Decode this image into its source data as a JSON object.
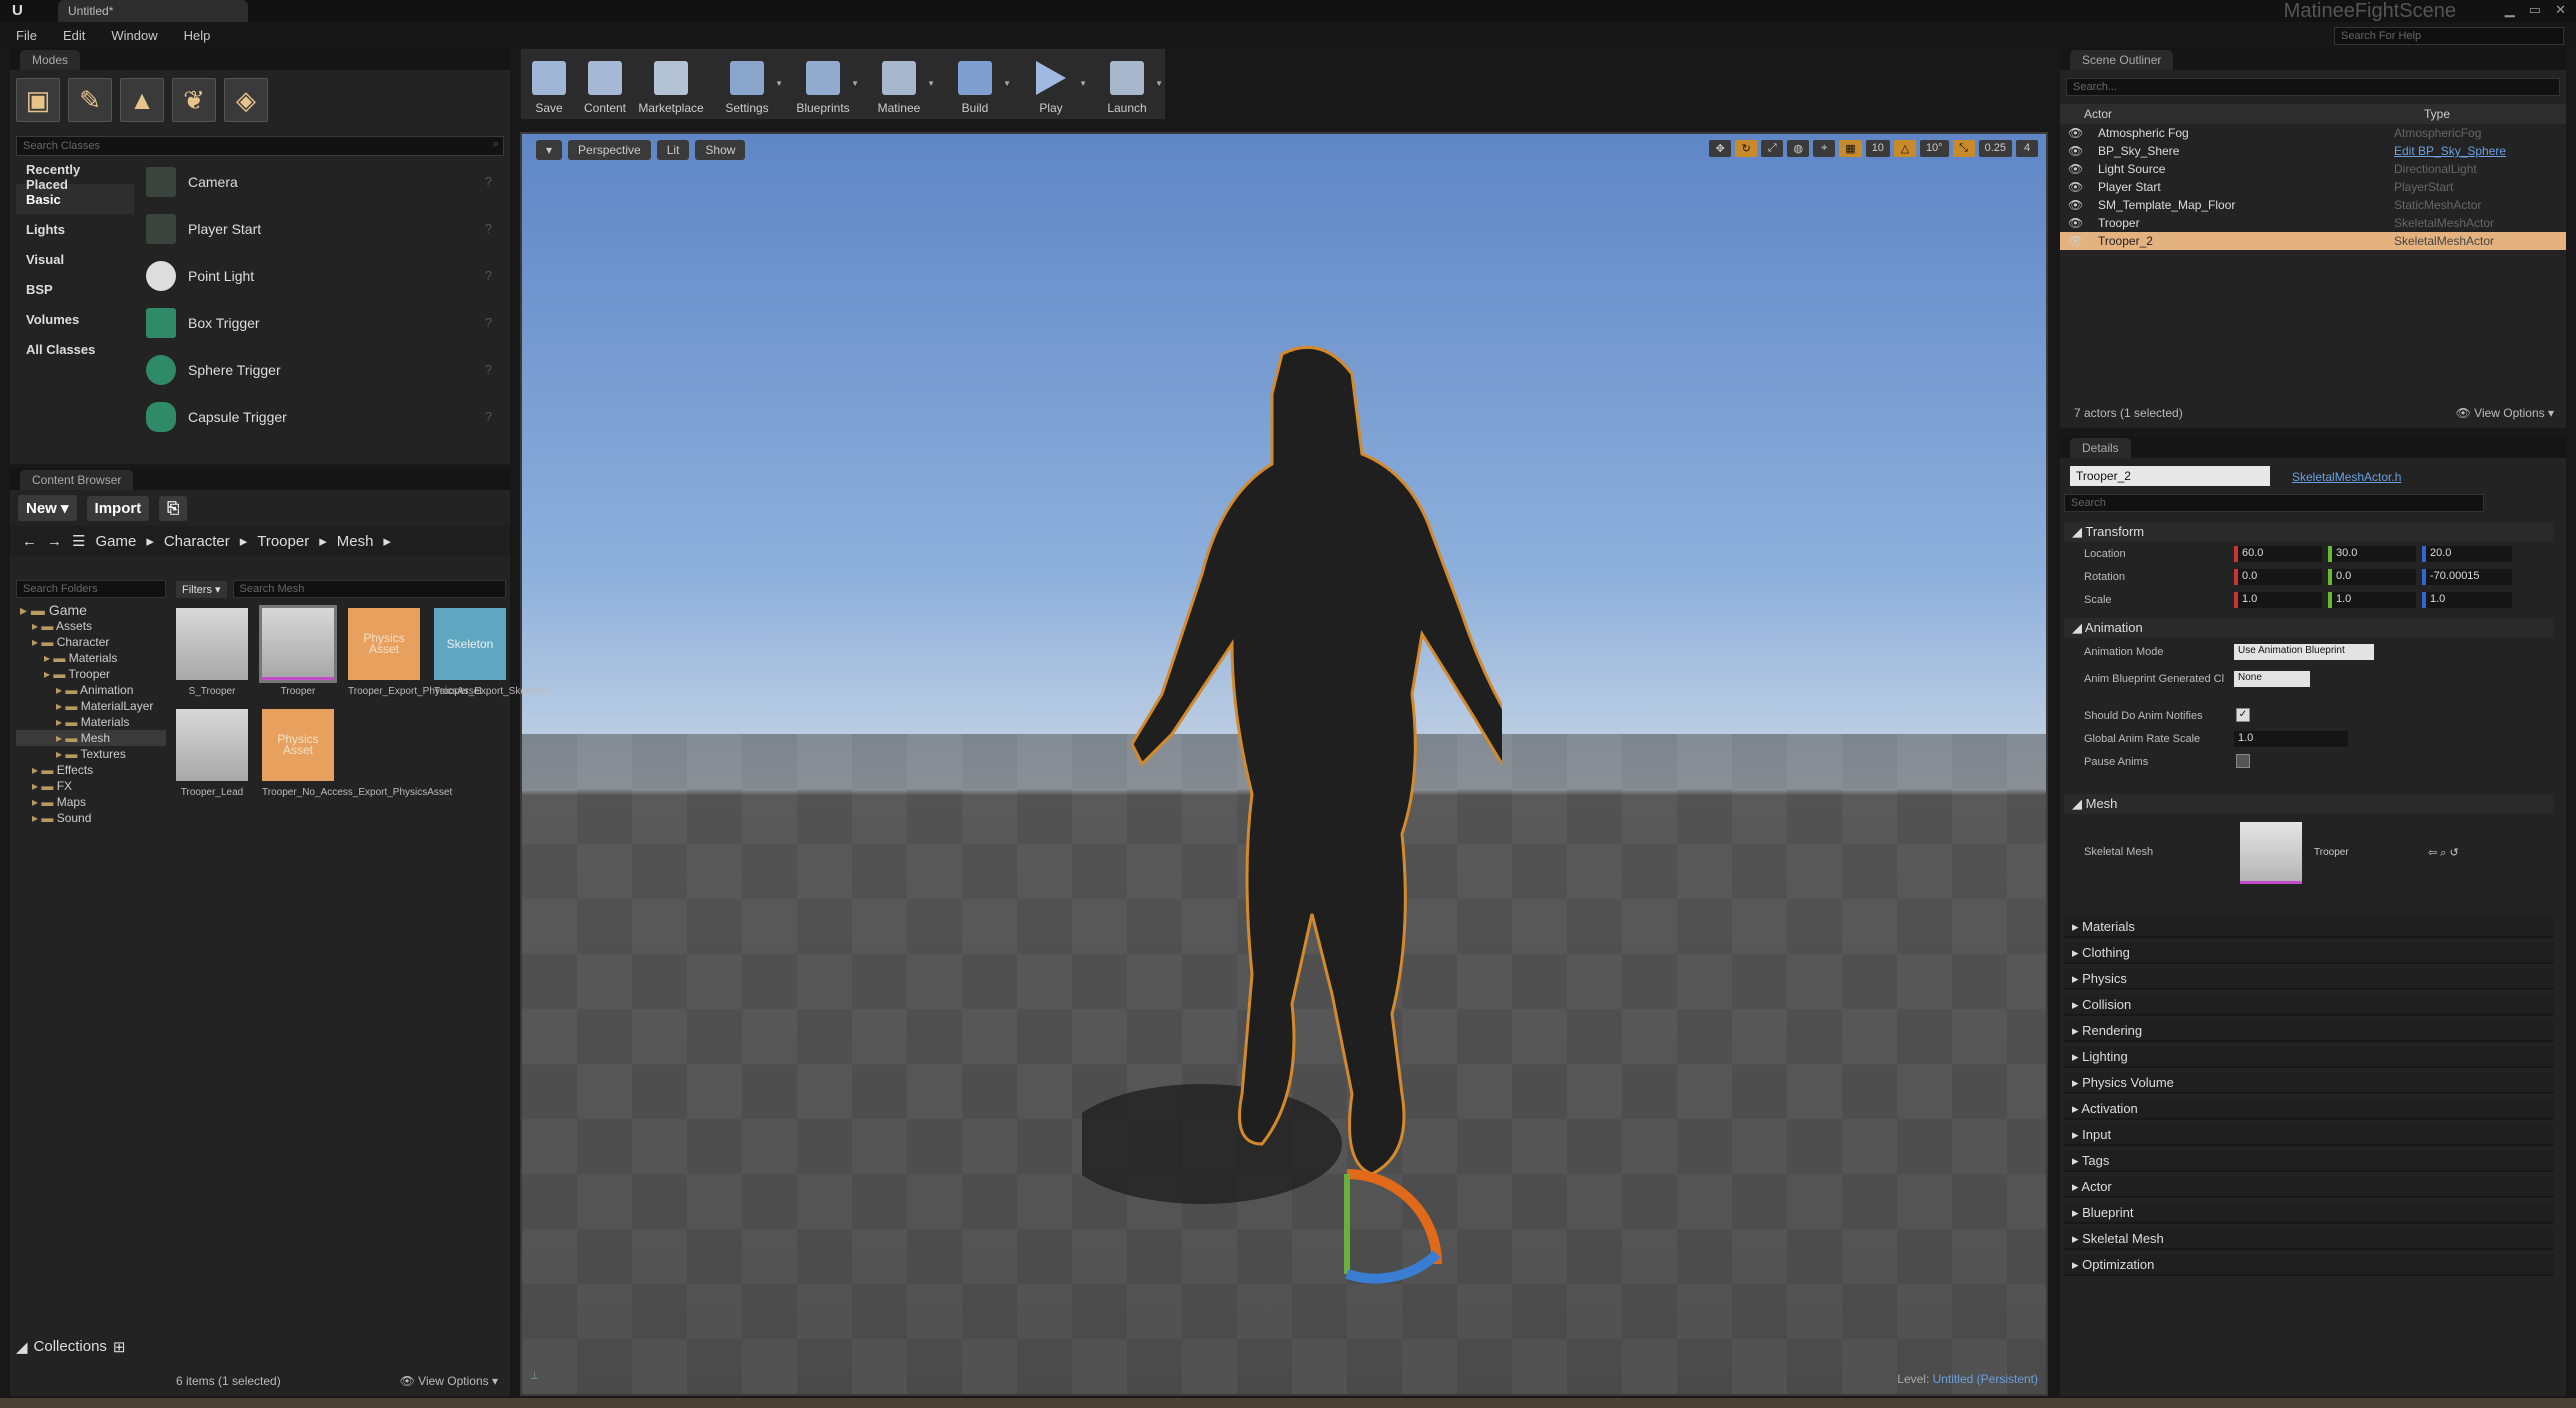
{
  "window": {
    "tab_title": "Untitled*",
    "project_name": "MatineeFightScene",
    "help_search_placeholder": "Search For Help",
    "logo": "U"
  },
  "menu": {
    "items": [
      "File",
      "Edit",
      "Window",
      "Help"
    ]
  },
  "modes": {
    "tab": "Modes",
    "search_placeholder": "Search Classes",
    "categories": [
      "Recently Placed",
      "Basic",
      "Lights",
      "Visual",
      "BSP",
      "Volumes",
      "All Classes"
    ],
    "selected_category": "Basic",
    "items": [
      "Camera",
      "Player Start",
      "Point Light",
      "Box Trigger",
      "Sphere Trigger",
      "Capsule Trigger"
    ],
    "icons": [
      "place-icon",
      "paint-icon",
      "landscape-icon",
      "foliage-icon",
      "geometry-edit-icon"
    ]
  },
  "toolbar": {
    "buttons": [
      "Save",
      "Content",
      "Marketplace",
      "Settings",
      "Blueprints",
      "Matinee",
      "Build",
      "Play",
      "Launch"
    ]
  },
  "viewport": {
    "perspective": "Perspective",
    "lit": "Lit",
    "show": "Show",
    "grid_snap": "10",
    "rot_snap": "10°",
    "scale_snap": "0.25",
    "cam_speed": "4",
    "level_prefix": "Level: ",
    "level_name": "Untitled (Persistent)"
  },
  "content_browser": {
    "tab": "Content Browser",
    "new_label": "New",
    "import_label": "Import",
    "breadcrumb": [
      "Game",
      "Character",
      "Trooper",
      "Mesh"
    ],
    "folder_search_placeholder": "Search Folders",
    "folders": [
      {
        "name": "Game",
        "depth": 0
      },
      {
        "name": "Assets",
        "depth": 1
      },
      {
        "name": "Character",
        "depth": 1
      },
      {
        "name": "Materials",
        "depth": 2
      },
      {
        "name": "Trooper",
        "depth": 2
      },
      {
        "name": "Animation",
        "depth": 3
      },
      {
        "name": "MaterialLayer",
        "depth": 3
      },
      {
        "name": "Materials",
        "depth": 3
      },
      {
        "name": "Mesh",
        "depth": 3
      },
      {
        "name": "Textures",
        "depth": 3
      },
      {
        "name": "Effects",
        "depth": 1
      },
      {
        "name": "FX",
        "depth": 1
      },
      {
        "name": "Maps",
        "depth": 1
      },
      {
        "name": "Sound",
        "depth": 1
      }
    ],
    "filters_label": "Filters",
    "search_placeholder": "Search Mesh",
    "assets": [
      {
        "name": "S_Trooper",
        "kind": "mesh",
        "thumb_text": ""
      },
      {
        "name": "Trooper",
        "kind": "mesh-sel",
        "thumb_text": ""
      },
      {
        "name": "Trooper_Export_PhysicsAsset",
        "kind": "phys",
        "thumb_text": "Physics Asset"
      },
      {
        "name": "Trooper_Export_Skeleton",
        "kind": "skel",
        "thumb_text": "Skeleton"
      },
      {
        "name": "Trooper_Lead",
        "kind": "mesh",
        "thumb_text": ""
      },
      {
        "name": "Trooper_No_Access_Export_PhysicsAsset",
        "kind": "phys",
        "thumb_text": "Physics Asset"
      }
    ],
    "collections": "Collections",
    "status": "6 items (1 selected)",
    "view_options": "View Options"
  },
  "outliner": {
    "tab": "Scene Outliner",
    "search_placeholder": "Search...",
    "col_actor": "Actor",
    "col_type": "Type",
    "rows": [
      {
        "name": "Atmospheric Fog",
        "type": "AtmosphericFog",
        "link": false
      },
      {
        "name": "BP_Sky_Shere",
        "type": "Edit BP_Sky_Sphere",
        "link": true
      },
      {
        "name": "Light Source",
        "type": "DirectionalLight",
        "link": false
      },
      {
        "name": "Player Start",
        "type": "PlayerStart",
        "link": false
      },
      {
        "name": "SM_Template_Map_Floor",
        "type": "StaticMeshActor",
        "link": false
      },
      {
        "name": "Trooper",
        "type": "SkeletalMeshActor",
        "link": false
      },
      {
        "name": "Trooper_2",
        "type": "SkeletalMeshActor",
        "link": false
      }
    ],
    "selected_index": 6,
    "status": "7 actors (1 selected)",
    "view_options": "View Options"
  },
  "details": {
    "tab": "Details",
    "name": "Trooper_2",
    "class": "SkeletalMeshActor.h",
    "search_placeholder": "Search",
    "transform": {
      "header": "Transform",
      "location_label": "Location",
      "rotation_label": "Rotation",
      "scale_label": "Scale",
      "location": [
        "60.0",
        "30.0",
        "20.0"
      ],
      "rotation": [
        "0.0",
        "0.0",
        "-70.00015"
      ],
      "scale": [
        "1.0",
        "1.0",
        "1.0"
      ]
    },
    "animation": {
      "header": "Animation",
      "mode_label": "Animation Mode",
      "mode_value": "Use Animation Blueprint",
      "bp_label": "Anim Blueprint Generated Cl",
      "bp_value": "None",
      "notifies_label": "Should Do Anim Notifies",
      "rate_label": "Global Anim Rate Scale",
      "rate_value": "1.0",
      "pause_label": "Pause Anims"
    },
    "mesh": {
      "header": "Mesh",
      "label": "Skeletal Mesh",
      "value": "Trooper"
    },
    "collapsed_sections": [
      "Materials",
      "Clothing",
      "Physics",
      "Collision",
      "Rendering",
      "Lighting",
      "Physics Volume",
      "Activation",
      "Input",
      "Tags",
      "Actor",
      "Blueprint",
      "Skeletal Mesh",
      "Optimization"
    ]
  }
}
